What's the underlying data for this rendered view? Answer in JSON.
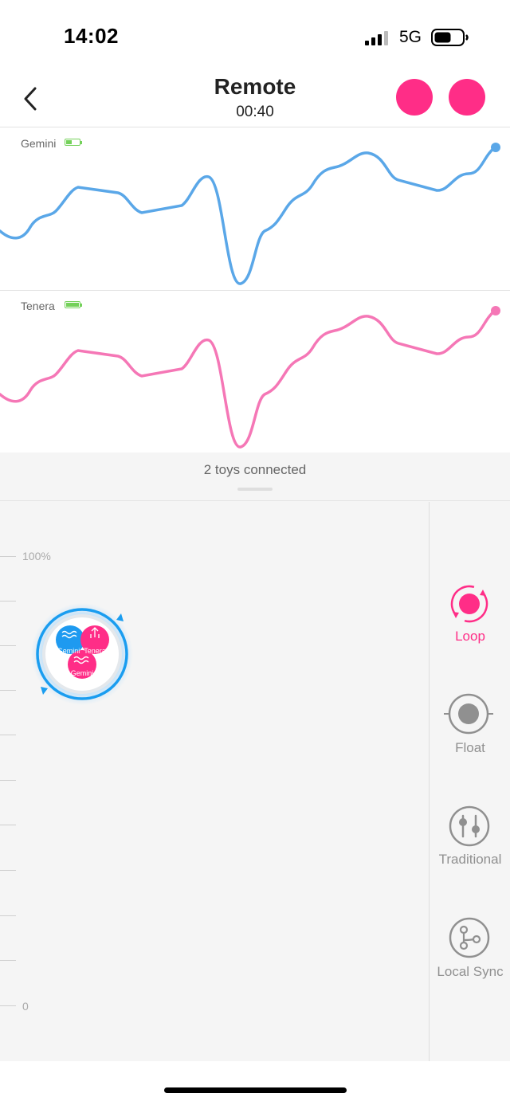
{
  "status_bar": {
    "time": "14:02",
    "network": "5G",
    "signal_bars": 4,
    "battery_level": 0.6
  },
  "header": {
    "title": "Remote",
    "timer": "00:40"
  },
  "colors": {
    "accent": "#ff2d87",
    "gemini": "#5aa7e8",
    "tenera": "#f577b6",
    "battery": "#74d15a",
    "blue_ring": "#1a9df0"
  },
  "toys": [
    {
      "name": "Gemini",
      "battery_level": 0.4
    },
    {
      "name": "Tenera",
      "battery_level": 1.0
    }
  ],
  "connected_text": "2 toys connected",
  "scale": {
    "max_label": "100%",
    "min_label": "0"
  },
  "toy_cluster": {
    "labels": [
      "Gemini",
      "Tenera",
      "Gemini"
    ]
  },
  "modes": [
    {
      "label": "Loop",
      "icon": "loop-icon",
      "active": true
    },
    {
      "label": "Float",
      "icon": "float-icon",
      "active": false
    },
    {
      "label": "Traditional",
      "icon": "sliders-icon",
      "active": false
    },
    {
      "label": "Local Sync",
      "icon": "sync-icon",
      "active": false
    }
  ]
}
